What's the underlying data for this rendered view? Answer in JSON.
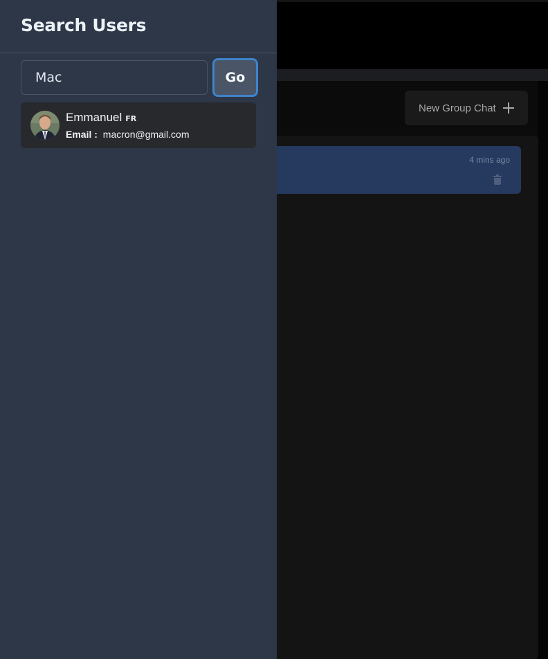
{
  "drawer": {
    "title": "Search Users",
    "search": {
      "value": "Mac",
      "placeholder": ""
    },
    "go_label": "Go",
    "results": [
      {
        "name": "Emmanuel",
        "badge": "FR",
        "email_label": "Email :",
        "email": "macron@gmail.com"
      }
    ]
  },
  "background": {
    "new_group_label": "New Group Chat",
    "chat_time": "4 mins ago"
  },
  "colors": {
    "drawer_bg": "#2d3748",
    "accent_focus": "#3f83c9",
    "selected_chat": "#26395e"
  }
}
